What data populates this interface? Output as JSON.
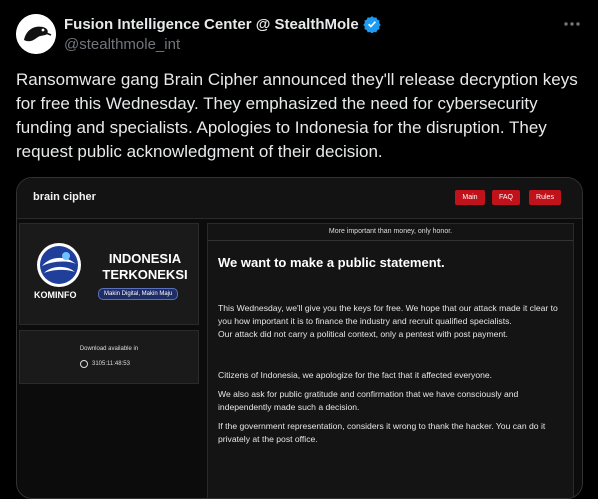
{
  "tweet": {
    "author_name": "Fusion Intelligence Center @ StealthMole",
    "handle": "@stealthmole_int",
    "more_icon": "more-icon",
    "text": "Ransomware gang Brain Cipher announced they'll release decryption keys for free this Wednesday. They emphasized the need for cybersecurity funding and specialists. Apologies to Indonesia for the disruption. They request public acknowledgment of their decision."
  },
  "site": {
    "brand": "brain cipher",
    "nav": [
      "Main",
      "FAQ",
      "Rules"
    ],
    "accent": "#c0121b"
  },
  "logo_card": {
    "kominfo_label": "KOMINFO",
    "title_line1": "INDONESIA",
    "title_line2": "TERKONEKSI",
    "tagline": "Makin Digital, Makin Maju"
  },
  "download_card": {
    "title": "Download available in",
    "countdown": "3105:11:48:53"
  },
  "statement": {
    "banner": "More important than money, only honor.",
    "heading": "We want to make a public statement.",
    "p1": "This Wednesday, we'll give you the keys for free. We hope that our attack made it clear to you how important it is to finance the industry and recruit qualified specialists.",
    "p2": "Our attack did not carry a political context, only a pentest with post payment.",
    "p3": "Citizens of Indonesia, we apologize for the fact that it affected everyone.",
    "p4": "We also ask for public gratitude and confirmation that we have consciously and independently made such a decision.",
    "p5": "If the government representation, considers it wrong to thank the hacker. You can do it privately at the post office."
  }
}
